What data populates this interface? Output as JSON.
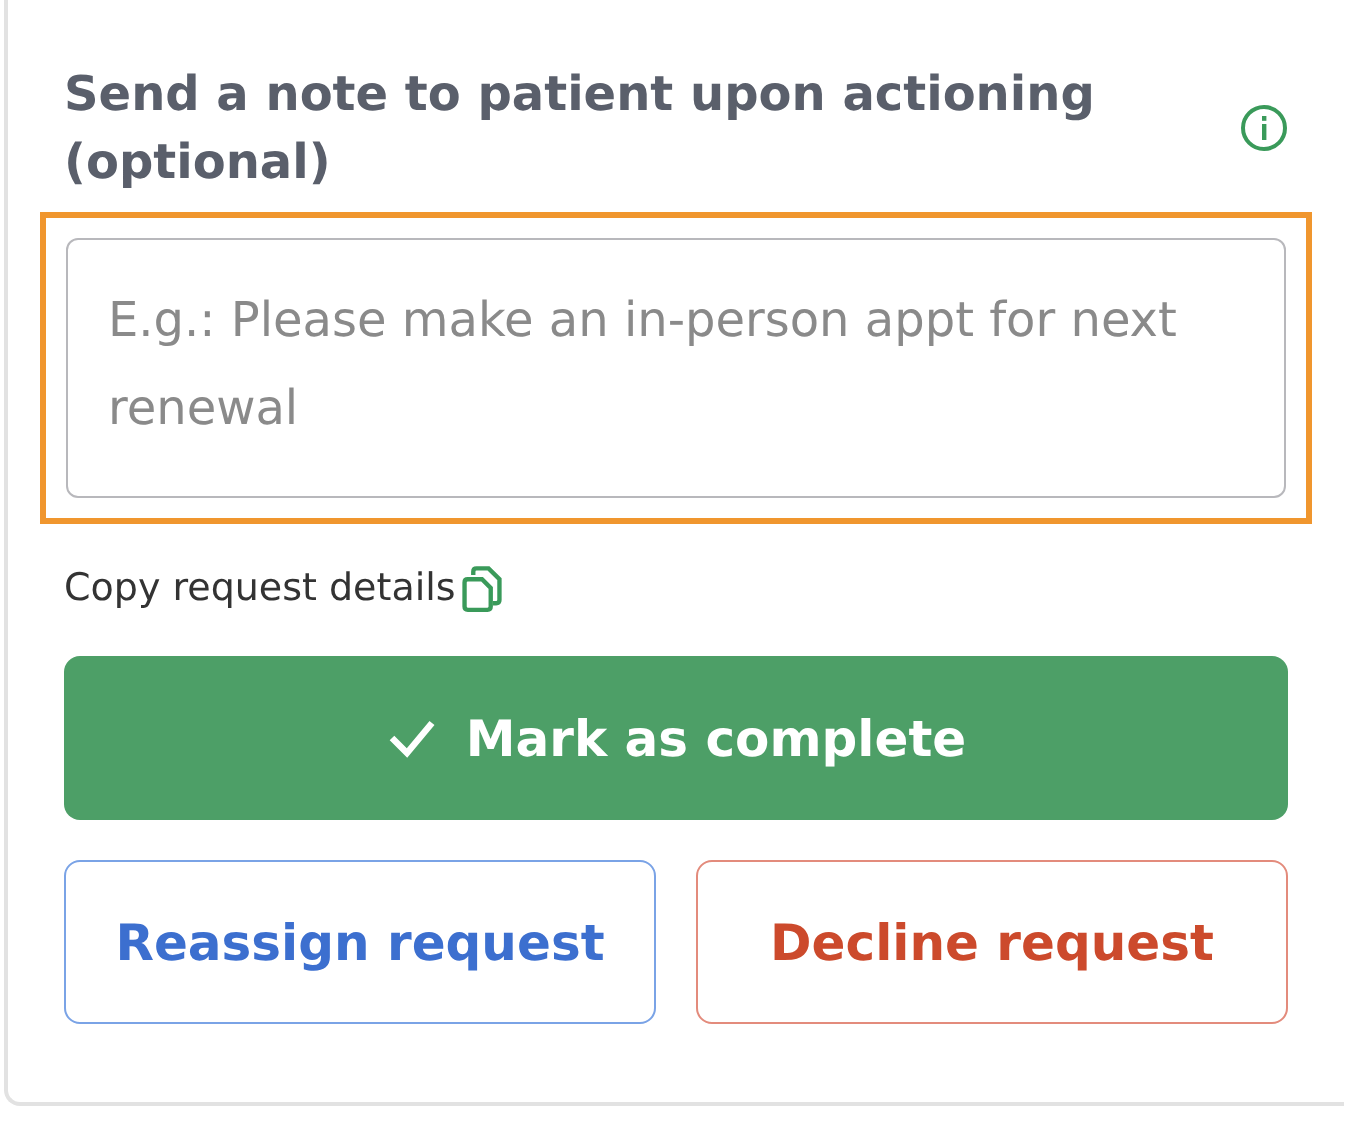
{
  "note": {
    "label": "Send a note to patient upon actioning (optional)",
    "placeholder": "E.g.: Please make an in-person appt for next renewal",
    "focused": true
  },
  "copy_link": {
    "label": "Copy request details"
  },
  "buttons": [
    {
      "kind": "primary",
      "label": "Mark as complete"
    },
    {
      "kind": "secondary",
      "label": "Reassign request"
    },
    {
      "kind": "danger",
      "label": "Decline request"
    }
  ]
}
